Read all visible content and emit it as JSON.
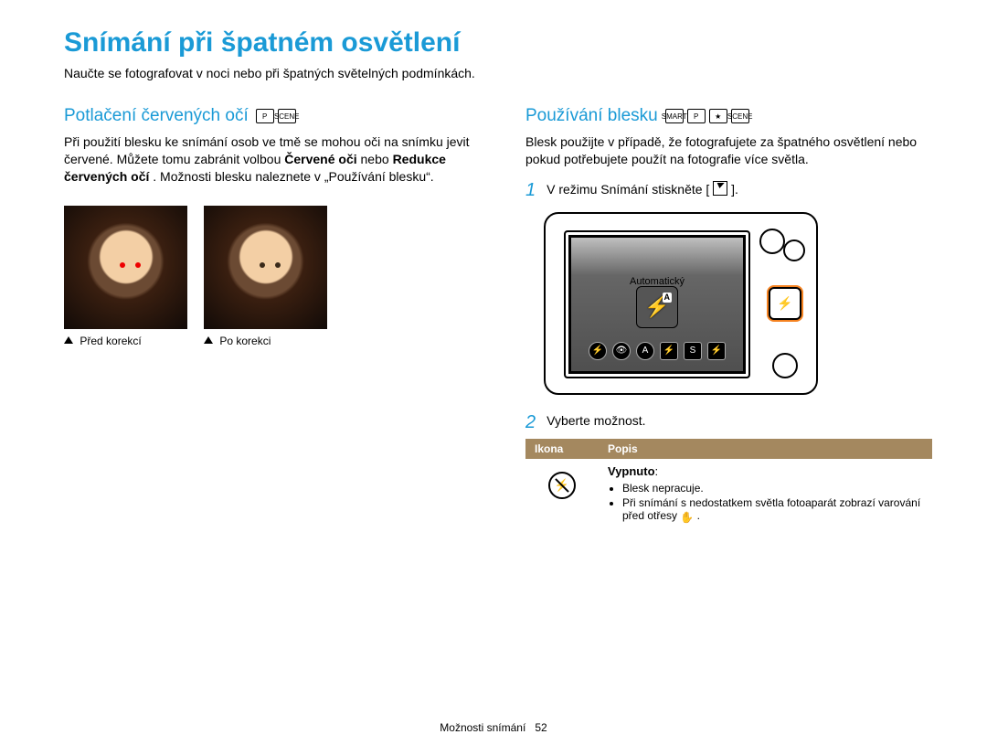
{
  "page_title": "Snímání při špatném osvětlení",
  "intro": "Naučte se fotografovat v noci nebo při špatných světelných podmínkách.",
  "left": {
    "heading": "Potlačení červených očí",
    "modes": [
      "P",
      "SCENE"
    ],
    "p1_a": "Při použití blesku ke snímání osob ve tmě se mohou oči na snímku jevit červené. Můžete tomu zabránit volbou ",
    "p1_strong1": "Červené oči",
    "p1_b": " nebo ",
    "p1_strong2": "Redukce červených očí",
    "p1_c": ". Možnosti blesku naleznete v „Používání blesku“.",
    "cap1": "Před korekcí",
    "cap2": "Po korekci"
  },
  "right": {
    "heading": "Používání blesku",
    "modes": [
      "SMART",
      "P",
      "★",
      "SCENE"
    ],
    "p1": "Blesk použijte v případě, že fotografujete za špatného osvětlení nebo pokud potřebujete použít na fotografie více světla.",
    "step1": "V režimu Snímání stiskněte [",
    "step1_after": "].",
    "camera_label": "Automatický",
    "camera_a_badge": "A",
    "step2": "Vyberte možnost.",
    "table": {
      "head_icon": "Ikona",
      "head_desc": "Popis",
      "row1_title": "Vypnuto",
      "row1_b1": "Blesk nepracuje.",
      "row1_b2_a": "Při snímání s nedostatkem světla fotoaparát zobrazí varování před otřesy ",
      "row1_b2_b": "."
    }
  },
  "footer": {
    "section": "Možnosti snímání",
    "page": "52"
  }
}
